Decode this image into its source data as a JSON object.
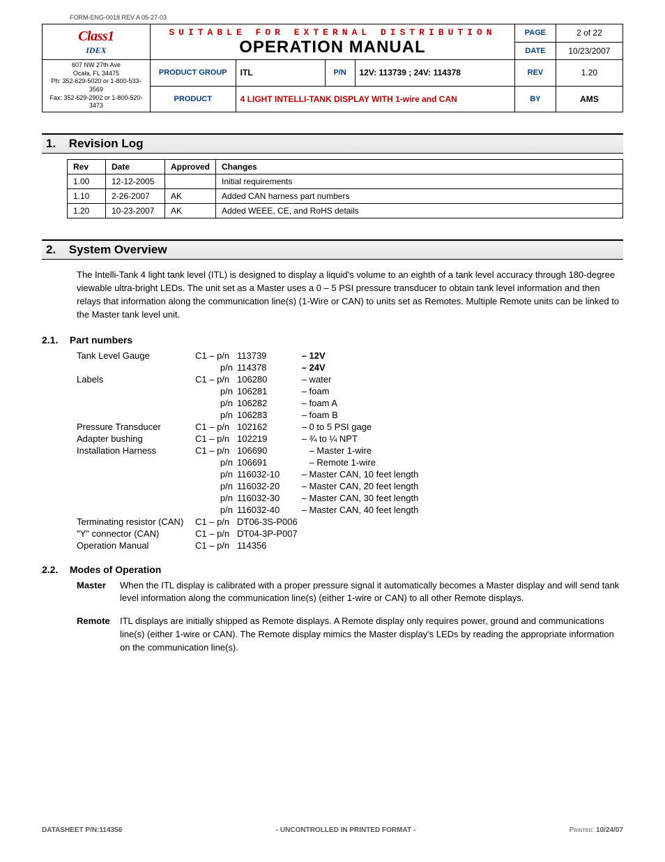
{
  "form_id": "FORM-ENG-0018 REV A 05-27-03",
  "header": {
    "logo1": "Class1",
    "logo2": "IDEX",
    "addr1": "607 NW 27th Ave",
    "addr2": "Ocala, FL 34475",
    "addr3": "Ph: 352-629-5020 or 1-800-533-3569",
    "addr4": "Fax: 352-629-2902 or 1-800-520-3473",
    "distribution": "SUITABLE FOR EXTERNAL DISTRIBUTION",
    "title": "OPERATION MANUAL",
    "labels": {
      "page": "PAGE",
      "date": "DATE",
      "product_group": "PRODUCT GROUP",
      "pn": "P/N",
      "rev": "REV",
      "product": "PRODUCT",
      "by": "BY"
    },
    "values": {
      "page": "2 of 22",
      "date": "10/23/2007",
      "product_group": "ITL",
      "pn": "12V: 113739 ; 24V: 114378",
      "rev": "1.20",
      "product": "4 LIGHT INTELLI-TANK DISPLAY WITH 1-wire and CAN",
      "by": "AMS"
    }
  },
  "sections": {
    "revlog": {
      "num": "1.",
      "title": "Revision Log",
      "cols": [
        "Rev",
        "Date",
        "Approved",
        "Changes"
      ],
      "rows": [
        {
          "rev": "1.00",
          "date": "12-12-2005",
          "approved": "",
          "changes": "Initial requirements"
        },
        {
          "rev": "1.10",
          "date": "2-26-2007",
          "approved": "AK",
          "changes": "Added CAN harness part numbers"
        },
        {
          "rev": "1.20",
          "date": "10-23-2007",
          "approved": "AK",
          "changes": "Added WEEE, CE, and RoHS details"
        }
      ]
    },
    "overview": {
      "num": "2.",
      "title": "System Overview",
      "text": "The Intelli-Tank 4 light tank level (ITL) is designed to display a liquid's volume to an eighth of a tank level accuracy through 180-degree viewable ultra-bright LEDs. The unit set as a Master uses a 0 – 5 PSI pressure transducer to obtain tank level information and then relays that information along the communication line(s) (1-Wire or CAN) to units set as Remotes.  Multiple Remote units can be linked to the Master tank level unit."
    },
    "partnums": {
      "num": "2.1.",
      "title": "Part numbers",
      "rows": [
        {
          "name": "Tank Level Gauge",
          "pfx": "C1 – p/n",
          "num": "113739",
          "desc": "– 12V",
          "bold": true
        },
        {
          "name": "",
          "pfx": "p/n",
          "num": "114378",
          "desc": "– 24V",
          "bold": true
        },
        {
          "name": "Labels",
          "pfx": "C1 – p/n",
          "num": "106280",
          "desc": "– water"
        },
        {
          "name": "",
          "pfx": "p/n",
          "num": "106281",
          "desc": "– foam"
        },
        {
          "name": "",
          "pfx": "p/n",
          "num": "106282",
          "desc": "– foam A"
        },
        {
          "name": "",
          "pfx": "p/n",
          "num": "106283",
          "desc": "– foam B"
        },
        {
          "name": "Pressure Transducer",
          "pfx": "C1 – p/n",
          "num": "102162",
          "desc": "– 0 to 5 PSI gage"
        },
        {
          "name": "Adapter bushing",
          "pfx": "C1 – p/n",
          "num": "102219",
          "desc": "– ¾ to ¼ NPT"
        },
        {
          "name": "Installation Harness",
          "pfx": "C1 – p/n",
          "num": "106690",
          "desc": "– Master 1-wire",
          "pad": true
        },
        {
          "name": "",
          "pfx": "p/n",
          "num": "106691",
          "desc": "– Remote 1-wire",
          "pad": true
        },
        {
          "name": "",
          "pfx": "p/n",
          "num": "116032-10",
          "desc": "– Master CAN, 10 feet length"
        },
        {
          "name": "",
          "pfx": "p/n",
          "num": "116032-20",
          "desc": "– Master CAN, 20 feet length"
        },
        {
          "name": "",
          "pfx": "p/n",
          "num": "116032-30",
          "desc": "– Master CAN, 30 feet length"
        },
        {
          "name": "",
          "pfx": "p/n",
          "num": "116032-40",
          "desc": "– Master CAN, 40 feet length"
        },
        {
          "name": "Terminating resistor (CAN)",
          "pfx": "C1 – p/n",
          "num": "DT06-3S-P006",
          "desc": ""
        },
        {
          "name": "\"Y\" connector (CAN)",
          "pfx": "C1 – p/n",
          "num": "DT04-3P-P007",
          "desc": ""
        },
        {
          "name": "Operation Manual",
          "pfx": "C1 – p/n",
          "num": "114356",
          "desc": ""
        }
      ]
    },
    "modes": {
      "num": "2.2.",
      "title": "Modes of Operation",
      "items": [
        {
          "label": "Master",
          "text": "When the ITL display is calibrated with a proper pressure signal it automatically becomes a Master display and will send tank level information along the communication line(s) (either 1-wire or CAN) to all other Remote displays."
        },
        {
          "label": "Remote",
          "text": "ITL displays are initially shipped as Remote displays.  A Remote display only requires power, ground and communications line(s) (either 1-wire or CAN).  The Remote display mimics the Master display's LEDs by reading the appropriate information on the communication line(s)."
        }
      ]
    }
  },
  "footer": {
    "left": "DATASHEET P/N:114356",
    "center": "- UNCONTROLLED IN PRINTED FORMAT -",
    "right_label": "Printed:",
    "right_value": " 10/24/07"
  }
}
